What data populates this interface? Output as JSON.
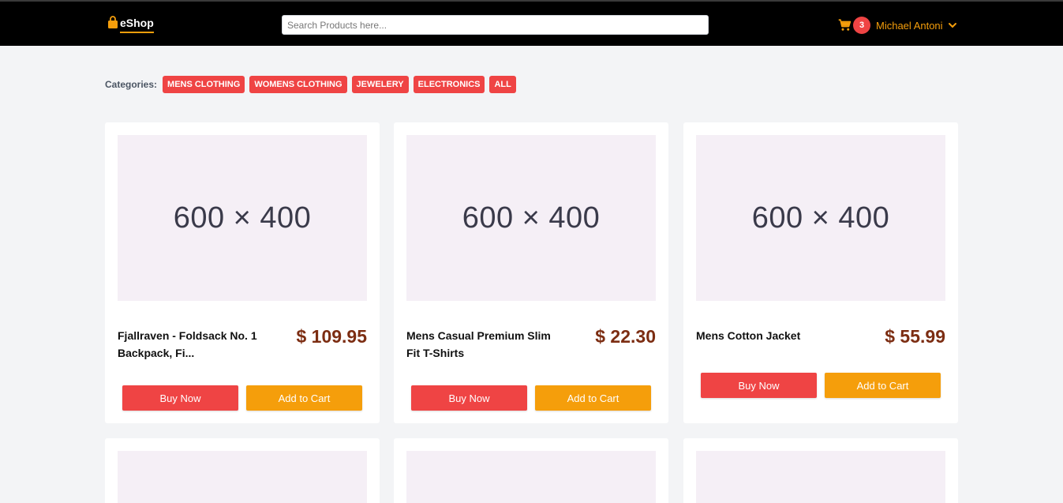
{
  "header": {
    "logo_text": "eShop",
    "search_placeholder": "Search Products here...",
    "cart_count": "3",
    "user_name": "Michael Antoni"
  },
  "categories": {
    "label": "Categories:",
    "items": [
      "MENS CLOTHING",
      "WOMENS CLOTHING",
      "JEWELERY",
      "ELECTRONICS",
      "ALL"
    ]
  },
  "products": [
    {
      "image_text": "600 × 400",
      "title": "Fjallraven - Foldsack No. 1 Backpack, Fi...",
      "price": "$ 109.95",
      "buy_label": "Buy Now",
      "cart_label": "Add to Cart"
    },
    {
      "image_text": "600 × 400",
      "title": "Mens Casual Premium Slim Fit T-Shirts",
      "price": "$ 22.30",
      "buy_label": "Buy Now",
      "cart_label": "Add to Cart"
    },
    {
      "image_text": "600 × 400",
      "title": "Mens Cotton Jacket",
      "price": "$ 55.99",
      "buy_label": "Buy Now",
      "cart_label": "Add to Cart"
    }
  ],
  "colors": {
    "header_bg": "#000000",
    "accent": "#f59e0b",
    "danger": "#ef4444",
    "price": "#7c2d12",
    "page_bg": "#f3f4f6"
  }
}
